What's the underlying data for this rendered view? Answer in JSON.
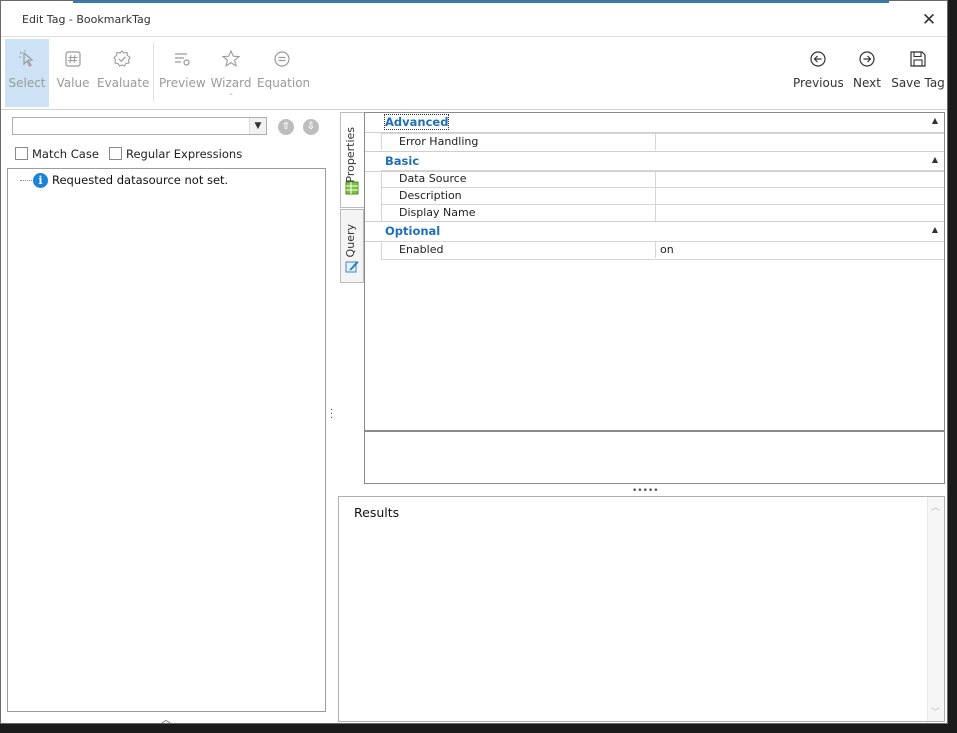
{
  "window": {
    "title": "Edit Tag - BookmarkTag",
    "close_glyph": "✕"
  },
  "toolbar": {
    "left": [
      {
        "label": "Select",
        "icon": "cursor-icon"
      },
      {
        "label": "Value",
        "icon": "hash-icon"
      },
      {
        "label": "Evaluate",
        "icon": "check-badge-icon"
      },
      {
        "label": "Preview",
        "icon": "preview-icon"
      },
      {
        "label": "Wizard",
        "icon": "wizard-icon"
      },
      {
        "label": "Equation",
        "icon": "equation-icon"
      }
    ],
    "right": [
      {
        "label": "Previous",
        "icon": "arrow-left-circle-icon"
      },
      {
        "label": "Next",
        "icon": "arrow-right-circle-icon"
      },
      {
        "label": "Save Tag",
        "icon": "save-icon"
      }
    ]
  },
  "left_panel": {
    "combo_value": "",
    "match_case_label": "Match Case",
    "regex_label": "Regular Expressions",
    "tree_message": "Requested datasource not set."
  },
  "side_tabs": {
    "properties": "Properties",
    "query": "Query"
  },
  "property_grid": {
    "categories": [
      {
        "name": "Advanced",
        "rows": [
          {
            "name": "Error Handling",
            "value": ""
          }
        ]
      },
      {
        "name": "Basic",
        "rows": [
          {
            "name": "Data Source",
            "value": ""
          },
          {
            "name": "Description",
            "value": ""
          },
          {
            "name": "Display Name",
            "value": ""
          }
        ]
      },
      {
        "name": "Optional",
        "rows": [
          {
            "name": "Enabled",
            "value": "on"
          }
        ]
      }
    ]
  },
  "results": {
    "label": "Results"
  },
  "colors": {
    "accent": "#1f83c9",
    "category_text": "#1f6fb5",
    "select_active_bg": "#cde3f5"
  }
}
